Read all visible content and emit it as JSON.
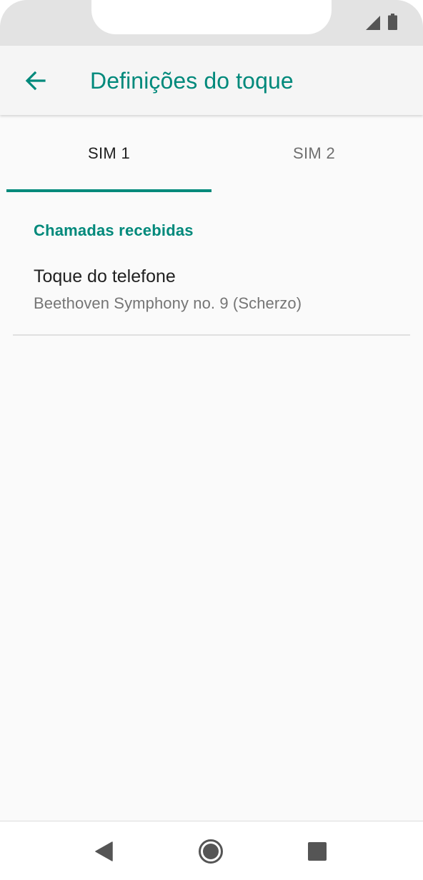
{
  "status_bar": {
    "icons": [
      "cell-signal-icon",
      "battery-icon"
    ]
  },
  "app_bar": {
    "back_icon": "arrow-left-icon",
    "title": "Definições do toque"
  },
  "tabs": [
    {
      "label": "SIM 1",
      "selected": true
    },
    {
      "label": "SIM 2",
      "selected": false
    }
  ],
  "section": {
    "header": "Chamadas recebidas",
    "items": [
      {
        "title": "Toque do telefone",
        "summary": "Beethoven Symphony no. 9 (Scherzo)"
      }
    ]
  },
  "nav_bar": {
    "buttons": [
      "back-triangle-icon",
      "home-circle-icon",
      "recents-square-icon"
    ]
  },
  "colors": {
    "accent": "#00897b",
    "status_bar": "#e3e3e3",
    "app_bar": "#f5f5f5",
    "background": "#fafafa"
  }
}
